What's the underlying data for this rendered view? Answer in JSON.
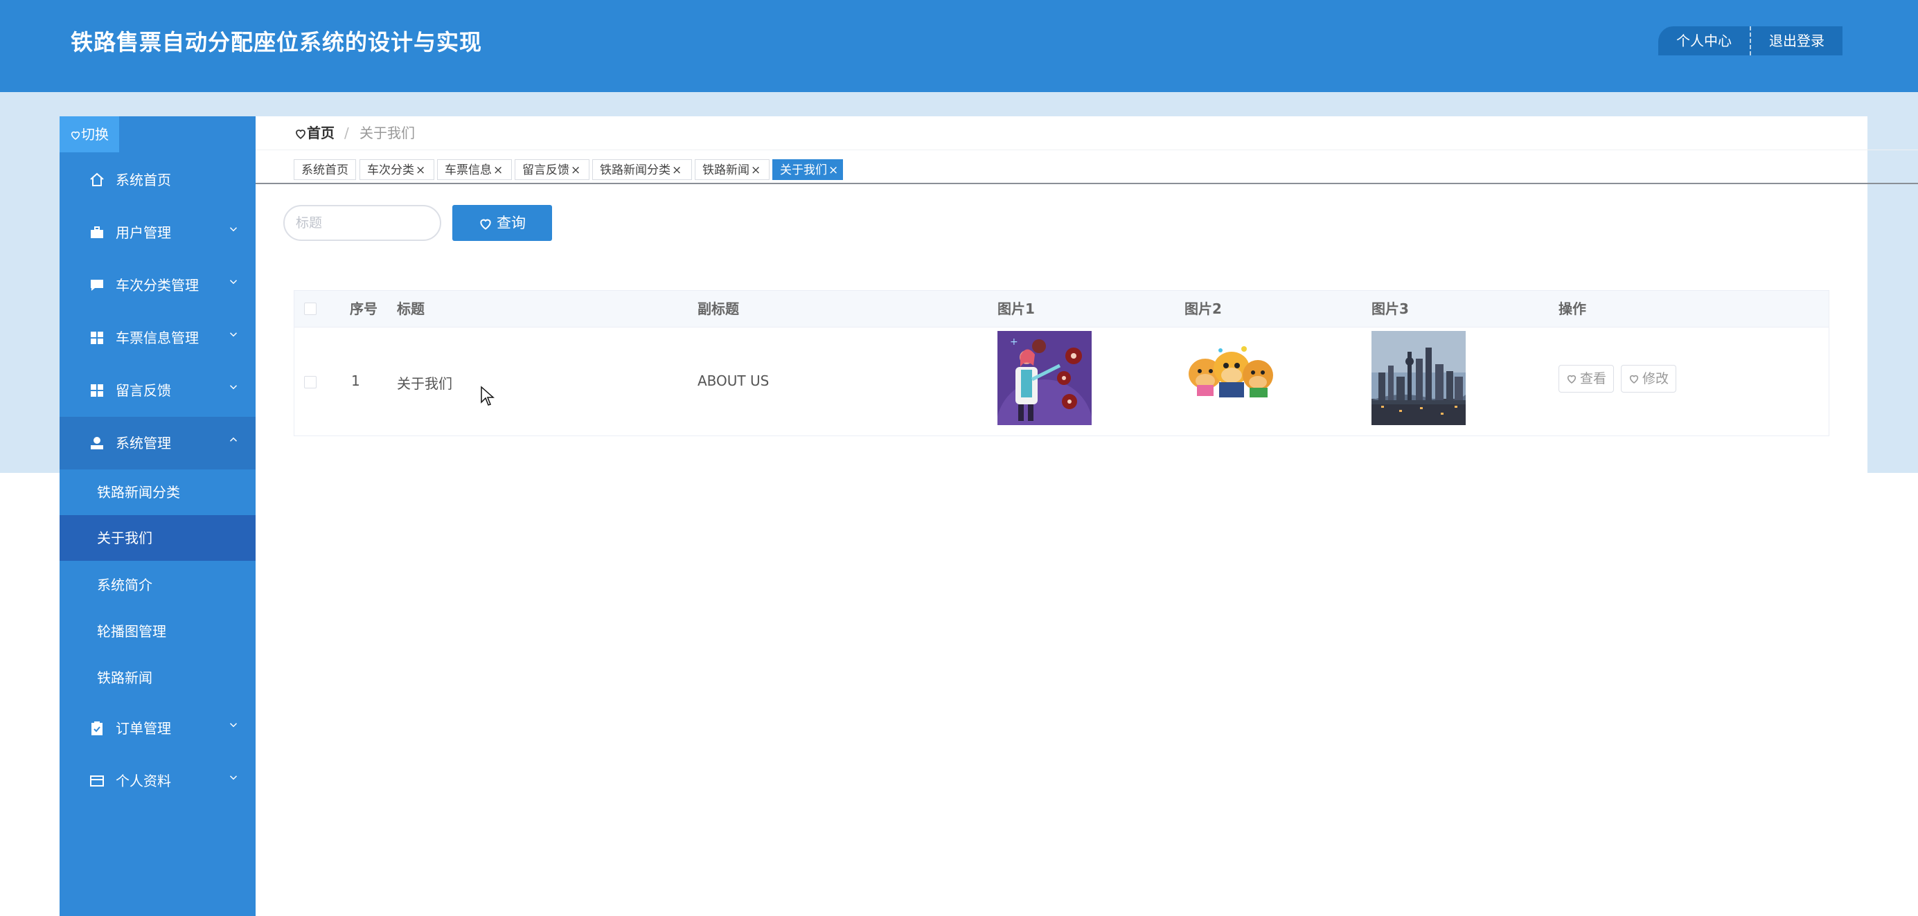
{
  "header": {
    "title": "铁路售票自动分配座位系统的设计与实现",
    "profile_label": "个人中心",
    "logout_label": "退出登录"
  },
  "sidebar": {
    "toggle_label": "切换",
    "items": [
      {
        "label": "系统首页",
        "icon": "home-icon",
        "expandable": false
      },
      {
        "label": "用户管理",
        "icon": "briefcase-icon",
        "expandable": true
      },
      {
        "label": "车次分类管理",
        "icon": "chat-icon",
        "expandable": true
      },
      {
        "label": "车票信息管理",
        "icon": "grid-icon",
        "expandable": true
      },
      {
        "label": "留言反馈",
        "icon": "grid-icon",
        "expandable": true
      },
      {
        "label": "系统管理",
        "icon": "user-icon",
        "expandable": true,
        "open": true
      },
      {
        "label": "订单管理",
        "icon": "clipboard-icon",
        "expandable": true
      },
      {
        "label": "个人资料",
        "icon": "card-icon",
        "expandable": true
      }
    ],
    "sub_items": [
      "铁路新闻分类",
      "关于我们",
      "系统简介",
      "轮播图管理",
      "铁路新闻"
    ],
    "active_sub": "关于我们"
  },
  "breadcrumb": {
    "home": "首页",
    "separator": "/",
    "current": "关于我们"
  },
  "tabs": [
    {
      "label": "系统首页",
      "closable": false
    },
    {
      "label": "车次分类",
      "closable": true
    },
    {
      "label": "车票信息",
      "closable": true
    },
    {
      "label": "留言反馈",
      "closable": true
    },
    {
      "label": "铁路新闻分类",
      "closable": true
    },
    {
      "label": "铁路新闻",
      "closable": true
    },
    {
      "label": "关于我们",
      "closable": true,
      "active": true
    }
  ],
  "search": {
    "placeholder": "标题",
    "button_label": "查询"
  },
  "table": {
    "columns": [
      "序号",
      "标题",
      "副标题",
      "图片1",
      "图片2",
      "图片3",
      "操作"
    ],
    "rows": [
      {
        "index": "1",
        "title": "关于我们",
        "subtitle": "ABOUT US",
        "image1": "doctor-illustration",
        "image2": "cartoon-characters",
        "image3": "city-skyline-photo",
        "actions": [
          "查看",
          "修改"
        ]
      }
    ]
  },
  "colors": {
    "primary": "#2e88d6",
    "sidebar": "#3189d8",
    "sidebar_open": "#2b77c5",
    "sidebar_active_sub": "#2663b8",
    "band": "#d4e6f5"
  }
}
